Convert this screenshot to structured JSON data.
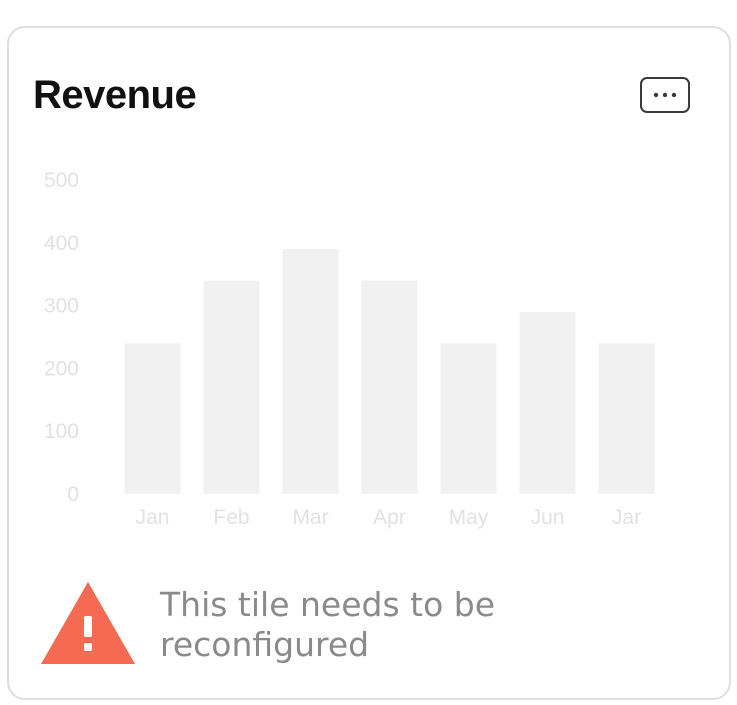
{
  "tile": {
    "title": "Revenue",
    "menu_icon": "more-horizontal-icon",
    "warning_icon": "warning-triangle-icon",
    "warning_color": "#f46a53",
    "warning_message": "This tile needs to be reconfigured"
  },
  "chart_data": {
    "type": "bar",
    "categories": [
      "Jan",
      "Feb",
      "Mar",
      "Apr",
      "May",
      "Jun",
      "Jar"
    ],
    "values": [
      240,
      340,
      390,
      340,
      240,
      290,
      240
    ],
    "y_ticks": [
      "500",
      "400",
      "300",
      "200",
      "100",
      "0"
    ],
    "ylim": [
      0,
      500
    ],
    "grid": false,
    "legend": "none",
    "bar_color": "#f1f1f1",
    "label_color": "#e2e2e2"
  }
}
